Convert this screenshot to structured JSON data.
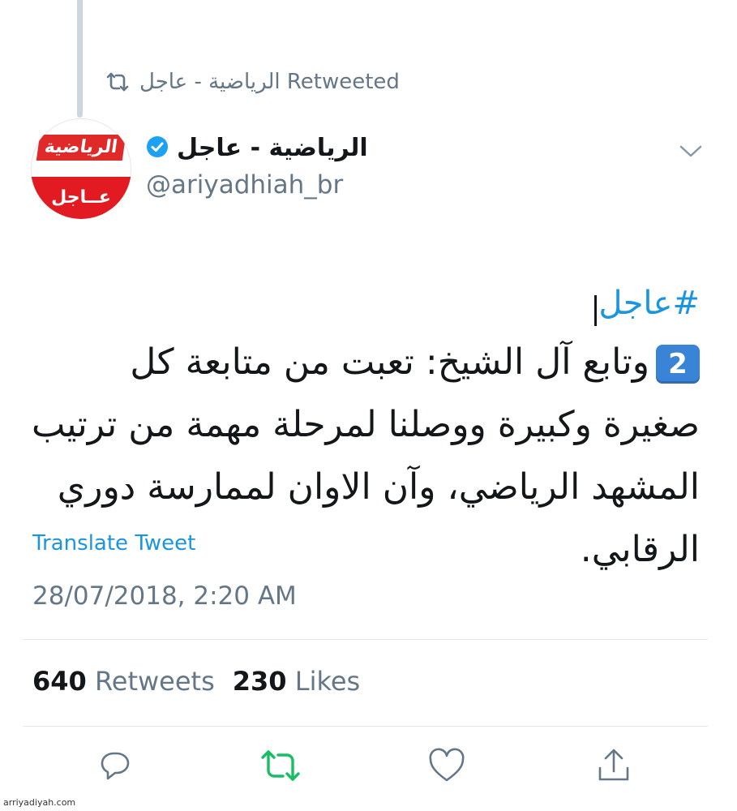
{
  "retweet_banner": {
    "text": "الرياضية - عاجل Retweeted",
    "icon": "retweet-icon"
  },
  "author": {
    "avatar_logo_text": "الرياضية",
    "avatar_badge_text": "عــاجل",
    "name": "الرياضية - عاجل",
    "verified_icon": "verified-badge-icon",
    "handle": "@ariyadhiah_br"
  },
  "tweet": {
    "hashtag": "#عاجل",
    "keycap_number": "2",
    "body": "وتابع آل الشيخ: تعبت من متابعة كل صغيرة وكبيرة ووصلنا لمرحلة مهمة من ترتيب المشهد الرياضي، وآن الاوان لممارسة دوري الرقابي."
  },
  "translate_label": "Translate Tweet",
  "timestamp": "28/07/2018, 2:20 AM",
  "stats": {
    "retweets_count": "640",
    "retweets_label": "Retweets",
    "likes_count": "230",
    "likes_label": "Likes"
  },
  "actions": [
    "reply-icon",
    "retweet-icon",
    "like-icon",
    "share-icon"
  ],
  "watermark": "arriyadiyah.com",
  "colors": {
    "link_blue": "#1b95e0",
    "retweet_green": "#17bf63",
    "secondary_gray": "#657786",
    "brand_red": "#e21b22"
  }
}
